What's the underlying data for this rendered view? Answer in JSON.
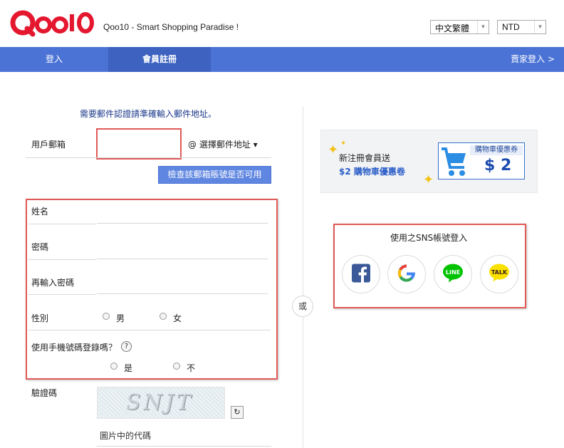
{
  "header": {
    "logo_text": "Qoo10",
    "slogan": "Qoo10 - Smart Shopping Paradise !",
    "language_select": "中文繁體",
    "currency_select": "NTD"
  },
  "nav": {
    "tabs": [
      {
        "label": "登入"
      },
      {
        "label": "會員註冊"
      }
    ],
    "seller_login": "賣家登入 >"
  },
  "form": {
    "intro": "需要郵件認證請準確輸入郵件地址。",
    "email_label": "用戶郵箱",
    "email_value": "",
    "email_domain_select": "@  選擇郵件地址 ▾",
    "check_button": "檢查該郵箱賬號是否可用",
    "name_label": "姓名",
    "password_label": "密碼",
    "password_confirm_label": "再輸入密碼",
    "gender_label": "性別",
    "gender_options": [
      "男",
      "女"
    ],
    "phone_login_label": "使用手機號碼登錄嗎？",
    "phone_login_options": [
      "是",
      "不"
    ],
    "help_icon": "?",
    "captcha_label": "驗證碼",
    "captcha_text": "SNJT",
    "refresh_icon": "↻",
    "captcha_hint": "圖片中的代碼"
  },
  "divider": {
    "or": "或"
  },
  "coupon": {
    "line1": "新注冊會員送",
    "line2": "$2 購物車優惠卷",
    "voucher_title": "購物車優惠券",
    "voucher_amount": "$ 2"
  },
  "sns": {
    "title": "使用之SNS帳號登入",
    "buttons": [
      {
        "name": "facebook-icon",
        "label": "f"
      },
      {
        "name": "google-icon",
        "label": "G"
      },
      {
        "name": "line-icon",
        "label": "LINE"
      },
      {
        "name": "kakaotalk-icon",
        "label": "TALK"
      }
    ]
  },
  "colors": {
    "brand_red": "#e4172f",
    "nav_blue": "#4b73d6",
    "highlight_red": "#e05a57",
    "facebook": "#3b5998",
    "line": "#00c300",
    "kakao": "#fae100"
  }
}
